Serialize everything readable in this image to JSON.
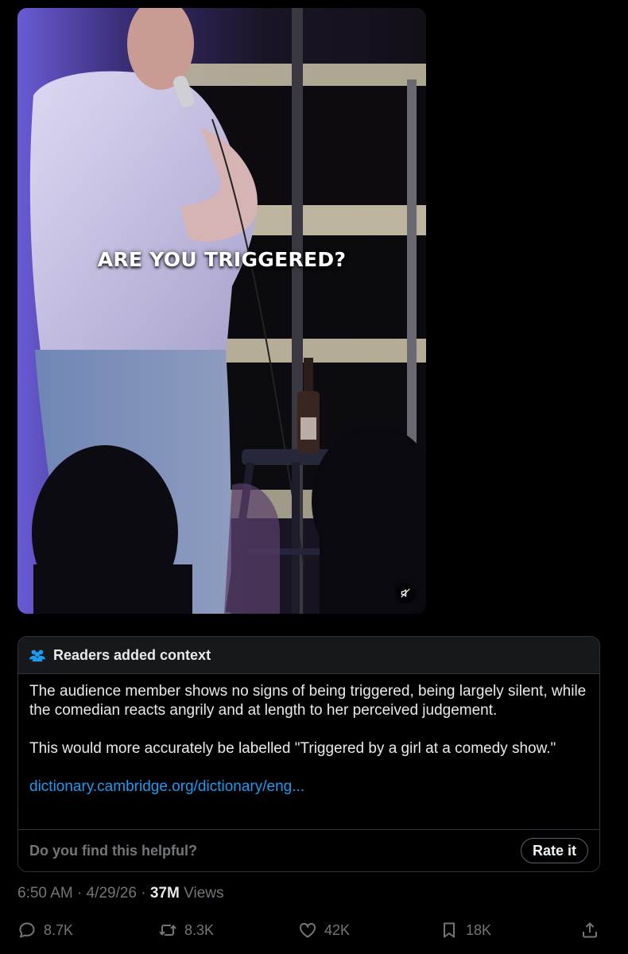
{
  "video": {
    "caption": "ARE YOU TRIGGERED?",
    "mute_icon": "speaker-muted-icon"
  },
  "note": {
    "icon": "people-icon",
    "title": "Readers added context",
    "paragraph1": "The audience member shows no signs of being triggered, being largely silent, while the comedian reacts angrily and at length to her perceived judgement.",
    "paragraph2": "This would more accurately be labelled \"Triggered by a girl at a comedy show.\"",
    "link": "dictionary.cambridge.org/dictionary/eng...",
    "helpful_question": "Do you find this helpful?",
    "rate_label": "Rate it"
  },
  "meta": {
    "time": "6:50 AM",
    "separator": " · ",
    "date": "4/29/26",
    "views_count": "37M",
    "views_label": " Views"
  },
  "actions": {
    "replies": "8.7K",
    "reposts": "8.3K",
    "likes": "42K",
    "bookmarks": "18K"
  },
  "colors": {
    "background": "#000000",
    "text_primary": "#e7e9ea",
    "text_secondary": "#71767b",
    "link": "#1d9bf0",
    "border": "#2f3336",
    "note_header_bg": "#16181c"
  }
}
